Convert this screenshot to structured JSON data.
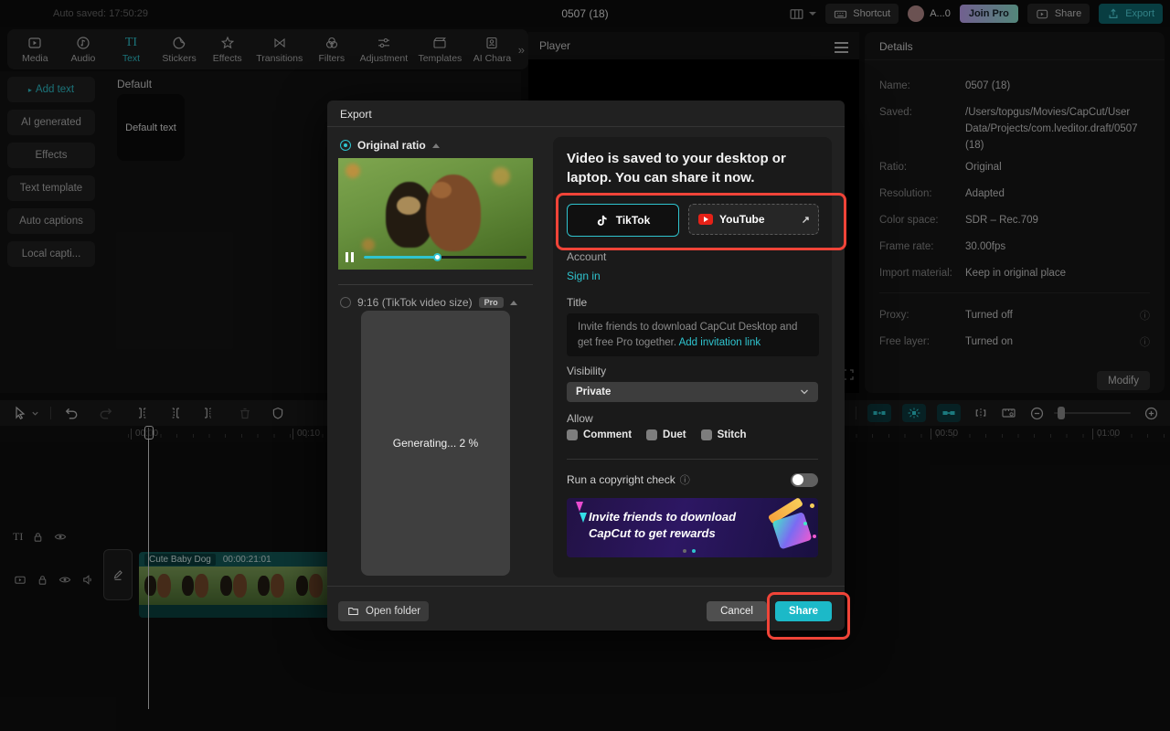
{
  "colors": {
    "accent": "#2fc4cf",
    "annotation_red": "#f04438",
    "export_btn": "#1cb9c8"
  },
  "icons": {
    "more": "»",
    "collapse": "▲",
    "item_caret": "▸",
    "external": "↗",
    "info": "ⓘ"
  },
  "topbar": {
    "auto_saved": "Auto saved: 17:50:29",
    "project_title": "0507 (18)",
    "shortcut_label": "Shortcut",
    "account_label": "A...0",
    "join_pro_label": "Join Pro",
    "share_label": "Share",
    "export_label": "Export"
  },
  "nav": {
    "tabs": [
      {
        "label": "Media"
      },
      {
        "label": "Audio"
      },
      {
        "label": "Text"
      },
      {
        "label": "Stickers"
      },
      {
        "label": "Effects"
      },
      {
        "label": "Transitions"
      },
      {
        "label": "Filters"
      },
      {
        "label": "Adjustment"
      },
      {
        "label": "Templates"
      },
      {
        "label": "AI Chara"
      }
    ]
  },
  "text_panel": {
    "items": [
      {
        "label": "Add text"
      },
      {
        "label": "AI generated"
      },
      {
        "label": "Effects"
      },
      {
        "label": "Text template"
      },
      {
        "label": "Auto captions"
      },
      {
        "label": "Local capti..."
      }
    ],
    "section_title": "Default",
    "default_card_label": "Default text"
  },
  "player": {
    "title": "Player"
  },
  "details": {
    "title": "Details",
    "rows": [
      {
        "label": "Name:",
        "value": "0507 (18)"
      },
      {
        "label": "Saved:",
        "value": "/Users/topgus/Movies/CapCut/User Data/Projects/com.lveditor.draft/0507 (18)"
      },
      {
        "label": "Ratio:",
        "value": "Original"
      },
      {
        "label": "Resolution:",
        "value": "Adapted"
      },
      {
        "label": "Color space:",
        "value": "SDR – Rec.709"
      },
      {
        "label": "Frame rate:",
        "value": "30.00fps"
      },
      {
        "label": "Import material:",
        "value": "Keep in original place"
      }
    ],
    "extra_rows": [
      {
        "label": "Proxy:",
        "value": "Turned off"
      },
      {
        "label": "Free layer:",
        "value": "Turned on"
      }
    ],
    "modify_label": "Modify"
  },
  "timeline": {
    "ruler_labels": [
      {
        "t": "00:00"
      },
      {
        "t": "00:10"
      },
      {
        "t": "00:50"
      },
      {
        "t": "01:00"
      }
    ],
    "clip_name": "Cute Baby Dog",
    "clip_duration": "00:00:21:01"
  },
  "dialog": {
    "title": "Export",
    "original_ratio_label": "Original ratio",
    "ratio_916_label": "9:16 (TikTok video size)",
    "pro_badge": "Pro",
    "generating_text": "Generating... 2 %",
    "saved_message": "Video is saved to your desktop or laptop. You can share it now.",
    "tiktok_label": "TikTok",
    "youtube_label": "YouTube",
    "account_label": "Account",
    "sign_in_label": "Sign in",
    "title_label": "Title",
    "title_placeholder": "Invite friends to download CapCut Desktop and get free Pro together. ",
    "title_link": "Add invitation link",
    "visibility_label": "Visibility",
    "visibility_value": "Private",
    "allow_label": "Allow",
    "allow_options": [
      {
        "label": "Comment"
      },
      {
        "label": "Duet"
      },
      {
        "label": "Stitch"
      }
    ],
    "copyright_label": "Run a copyright check",
    "banner_text": "Invite friends to download CapCut to get rewards",
    "open_folder_label": "Open folder",
    "cancel_label": "Cancel",
    "share_label": "Share"
  }
}
